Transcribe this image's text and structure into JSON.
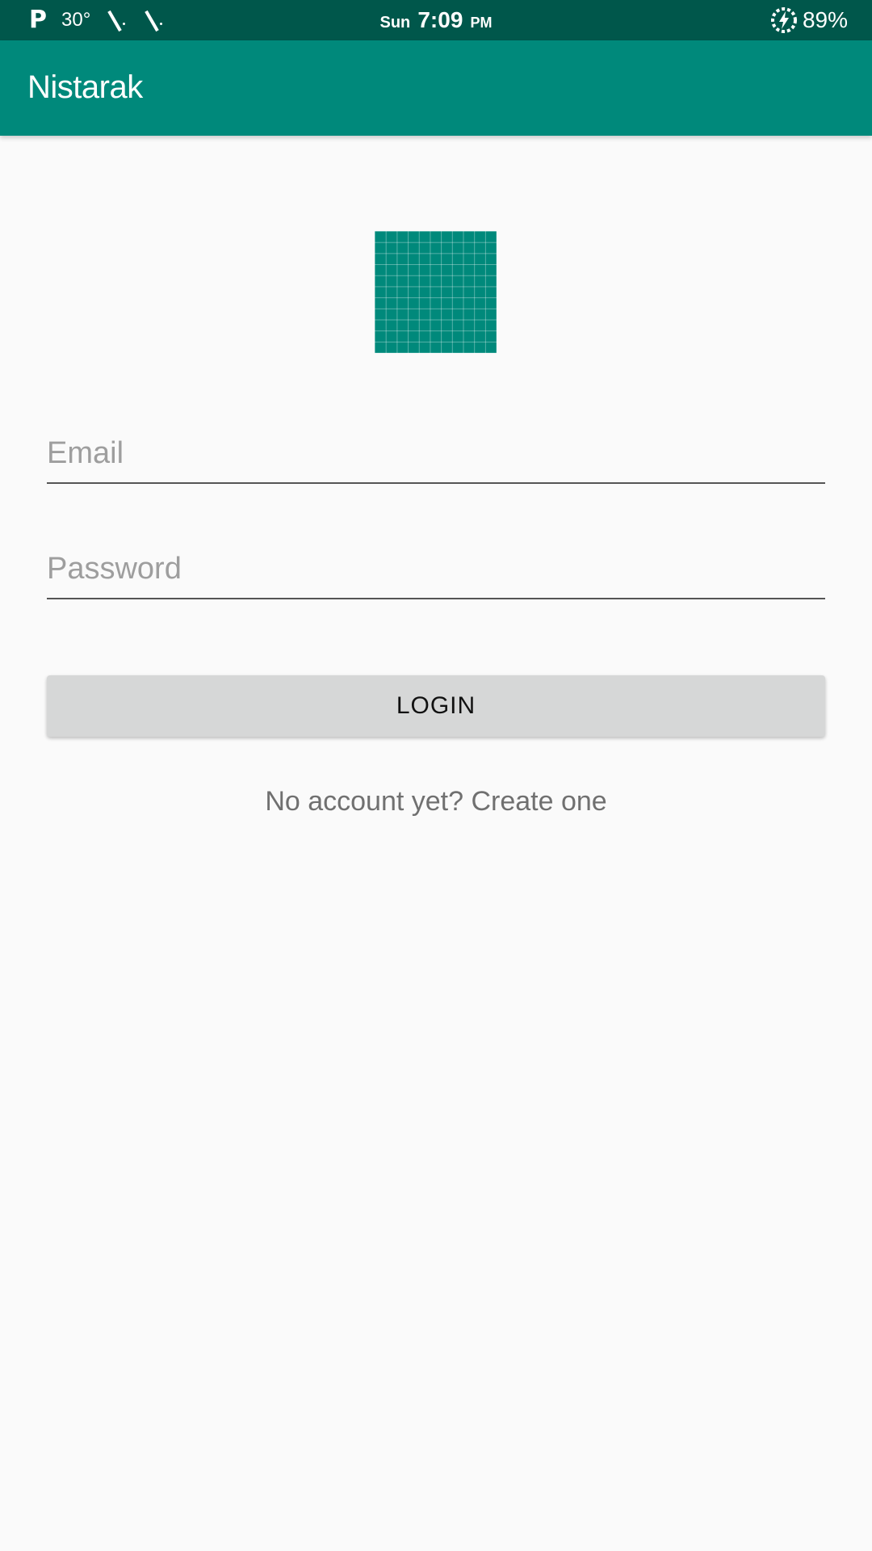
{
  "status_bar": {
    "carrier_icon": "P",
    "temperature": "30°",
    "day": "Sun",
    "time": "7:09",
    "ampm": "PM",
    "battery": "89%"
  },
  "app_bar": {
    "title": "Nistarak"
  },
  "logo": {
    "icon": "app-logo-grid"
  },
  "form": {
    "email_placeholder": "Email",
    "password_placeholder": "Password",
    "login_label": "LOGIN",
    "signup_text": "No account yet? Create one"
  },
  "colors": {
    "status_bar": "#00574b",
    "primary": "#00897b",
    "background": "#fafafa",
    "button": "#d6d7d7"
  }
}
